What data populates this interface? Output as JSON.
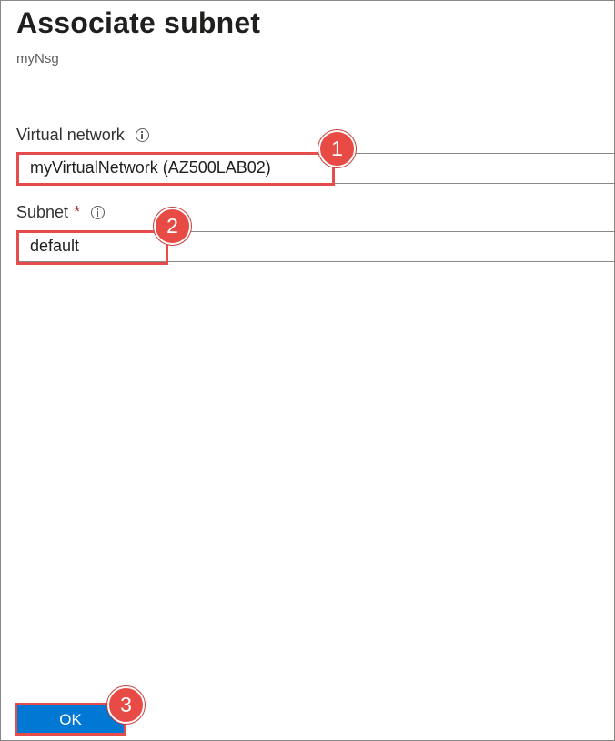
{
  "blade": {
    "title": "Associate subnet",
    "subtitle": "myNsg"
  },
  "form": {
    "virtual_network": {
      "label": "Virtual network",
      "value": "myVirtualNetwork (AZ500LAB02)"
    },
    "subnet": {
      "label": "Subnet",
      "required_marker": "*",
      "value": "default"
    }
  },
  "footer": {
    "ok_label": "OK"
  },
  "annotations": {
    "step1": "1",
    "step2": "2",
    "step3": "3",
    "highlight_color": "#e74c4c"
  },
  "colors": {
    "primary_button": "#0078d4",
    "badge": "#e84a45"
  }
}
